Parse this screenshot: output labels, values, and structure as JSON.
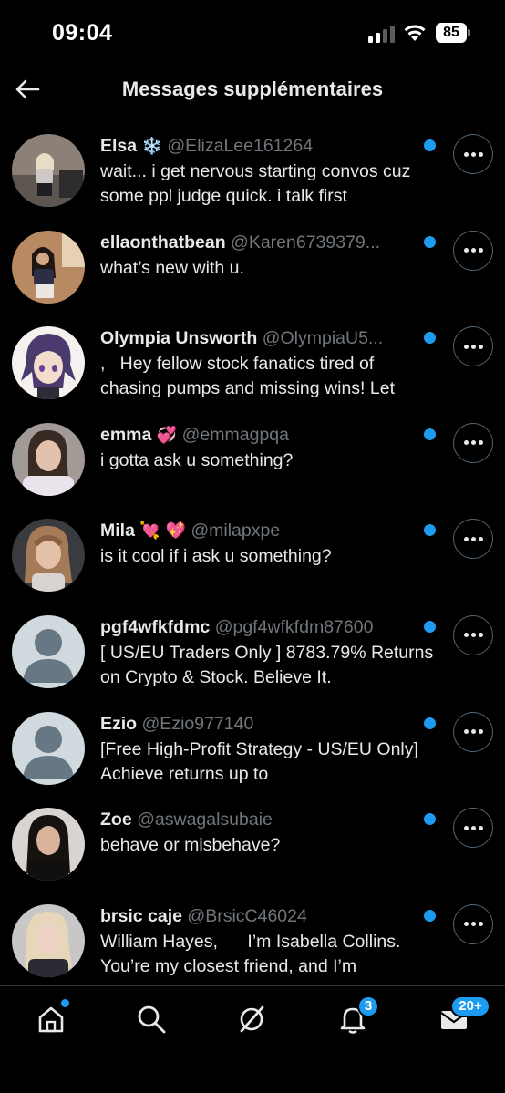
{
  "status_bar": {
    "time": "09:04",
    "battery": "85"
  },
  "header": {
    "title": "Messages supplémentaires"
  },
  "conversations": [
    {
      "name": "Elsa",
      "emoji": "❄️",
      "handle": "@ElizaLee161264",
      "message": "wait... i get nervous starting convos cuz some ppl judge quick. i talk first",
      "unread": true
    },
    {
      "name": "ellaonthatbean",
      "emoji": "",
      "handle": "@Karen6739379...",
      "message": "what’s new with u.",
      "unread": true
    },
    {
      "name": "Olympia Unsworth",
      "emoji": "",
      "handle": "@OlympiaU5...",
      "message": ",   Hey fellow stock fanatics tired of chasing pumps and missing wins! Let",
      "unread": true
    },
    {
      "name": "emma",
      "emoji": "💞",
      "handle": "@emmagpqa",
      "message": "i gotta ask u something?",
      "unread": true
    },
    {
      "name": "Mila",
      "emoji": "💘 💖",
      "handle": "@milapxpe",
      "message": "is it cool if i ask u something?",
      "unread": true
    },
    {
      "name": "pgf4wfkfdmc",
      "emoji": "",
      "handle": "@pgf4wfkfdm87600",
      "message": "[ US/EU Traders Only ] 8783.79% Returns on Crypto & Stock. Believe It.",
      "unread": true
    },
    {
      "name": "Ezio",
      "emoji": "",
      "handle": "@Ezio977140",
      "message": "[Free High-Profit Strategy - US/EU Only] Achieve returns up to",
      "unread": true
    },
    {
      "name": "Zoe",
      "emoji": "",
      "handle": "@aswagalsubaie",
      "message": "behave or misbehave?",
      "unread": true
    },
    {
      "name": "brsic caje",
      "emoji": "",
      "handle": "@BrsicC46024",
      "message": "William Hayes,      I’m Isabella Collins. You’re my closest friend, and I’m",
      "unread": true
    }
  ],
  "tabbar": {
    "notifications_badge": "3",
    "messages_badge": "20+"
  },
  "colors": {
    "accent": "#1d9bf0",
    "text": "#e7e9ea",
    "secondary": "#71767b",
    "background": "#000000"
  }
}
